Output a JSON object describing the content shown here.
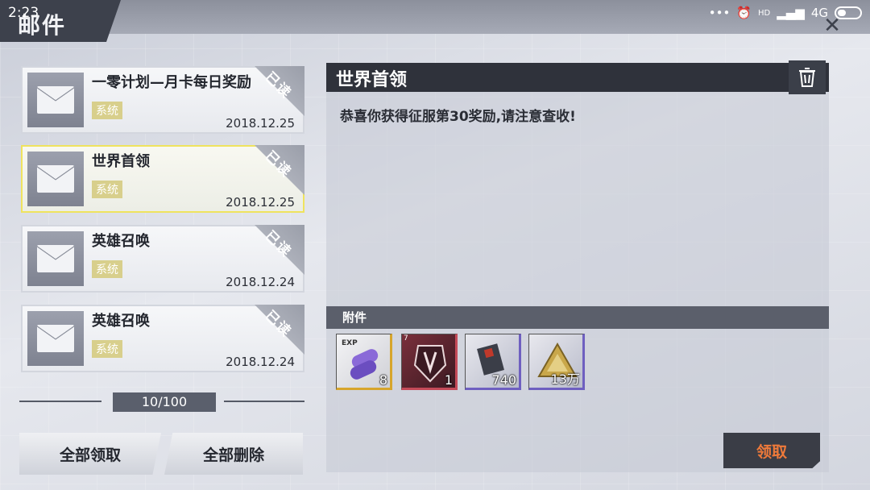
{
  "status": {
    "time": "2:23",
    "network": "4G",
    "hd": "HD"
  },
  "header": {
    "title": "邮件"
  },
  "mails": [
    {
      "title": "一零计划—月卡每日奖励",
      "tag": "系统",
      "date": "2018.12.25",
      "read": "已读"
    },
    {
      "title": "世界首领",
      "tag": "系统",
      "date": "2018.12.25",
      "read": "已读"
    },
    {
      "title": "英雄召唤",
      "tag": "系统",
      "date": "2018.12.24",
      "read": "已读"
    },
    {
      "title": "英雄召唤",
      "tag": "系统",
      "date": "2018.12.24",
      "read": "已读"
    }
  ],
  "pager": {
    "text": "10/100"
  },
  "buttons": {
    "claim_all": "全部领取",
    "delete_all": "全部删除",
    "claim": "领取"
  },
  "detail": {
    "title": "世界首领",
    "body": "恭喜你获得征服第30奖励,请注意查收!",
    "attachment_label": "附件",
    "items": [
      {
        "name": "exp-capsule",
        "label": "EXP",
        "qty": "8",
        "color": "#c9a23a"
      },
      {
        "name": "emblem-item",
        "label": "7",
        "qty": "1",
        "color": "#c44a58"
      },
      {
        "name": "card-item",
        "label": "",
        "qty": "740",
        "color": "#6e5fc0"
      },
      {
        "name": "gold-token",
        "label": "",
        "qty": "13万",
        "color": "#6e5fc0"
      }
    ]
  }
}
